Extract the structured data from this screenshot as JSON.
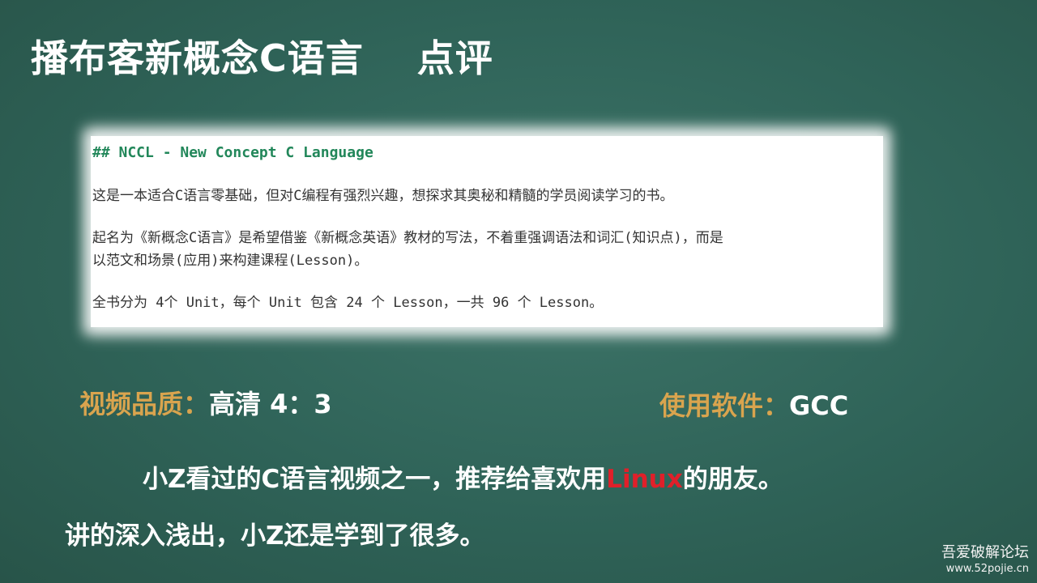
{
  "slide": {
    "title_main": "播布客新概念C语言",
    "title_tag": "点评"
  },
  "excerpt": {
    "heading": "## NCCL - New Concept C Language",
    "paragraph_1": "这是一本适合C语言零基础，但对C编程有强烈兴趣，想探求其奥秘和精髓的学员阅读学习的书。",
    "paragraph_2_line_1": "起名为《新概念C语言》是希望借鉴《新概念英语》教材的写法，不着重强调语法和词汇(知识点)，而是",
    "paragraph_2_line_2": "以范文和场景(应用)来构建课程(Lesson)。",
    "paragraph_3": "全书分为 4个 Unit，每个 Unit 包含 24 个 Lesson，一共 96 个 Lesson。"
  },
  "specs": {
    "quality_label": "视频品质：",
    "quality_value": "高清 4：3",
    "software_label": "使用软件：",
    "software_value": "GCC"
  },
  "remark": {
    "line_1_before": "小Z看过的C语言视频之一，推荐给喜欢用",
    "line_1_highlight": "Linux",
    "line_1_after": "的朋友。",
    "line_2": "讲的深入浅出，小Z还是学到了很多。"
  },
  "watermark": {
    "name": "吾爱破解论坛",
    "url": "www.52pojie.cn"
  },
  "colors": {
    "background": "#2f6358",
    "label_gold": "#d9a44e",
    "highlight_red": "#e0202a",
    "heading_green": "#22875a"
  }
}
